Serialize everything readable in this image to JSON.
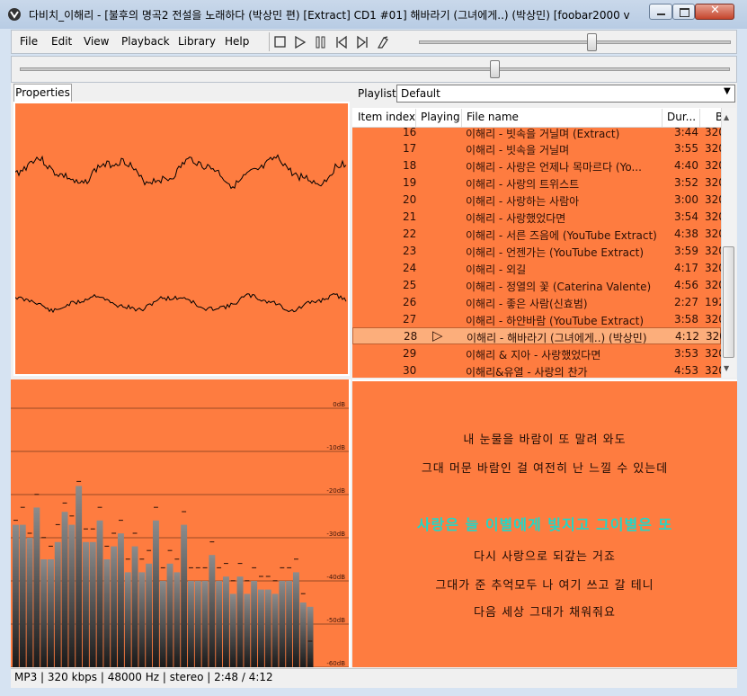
{
  "window": {
    "title": "다비치_이해리 - [불후의 명곡2 전설을 노래하다 (박상민 편) [Extract] CD1 #01] 해바라기 (그녀에게..) (박상민)     [foobar2000 v"
  },
  "menu": {
    "items": [
      "File",
      "Edit",
      "View",
      "Playback",
      "Library",
      "Help"
    ]
  },
  "toolbar": {
    "icons": [
      "stop-icon",
      "play-icon",
      "pause-icon",
      "previous-icon",
      "next-icon",
      "random-icon"
    ],
    "volume_level": 0.55
  },
  "seek": {
    "position_fraction": 0.667
  },
  "properties_tab": {
    "label": "Properties"
  },
  "playlist": {
    "label": "Playlist:",
    "selected": "Default",
    "columns": [
      "Item index",
      "Playing",
      "File name",
      "Dur...",
      "B"
    ],
    "rows": [
      {
        "index": "16",
        "file": "이해리 - 빗속을 거닐며 (Extract)",
        "duration": "3:44",
        "bitrate": "320"
      },
      {
        "index": "17",
        "file": "이해리 - 빗속을 거닐며",
        "duration": "3:55",
        "bitrate": "320"
      },
      {
        "index": "18",
        "file": "이해리 - 사랑은 언제나 목마르다 (Yo...",
        "duration": "4:40",
        "bitrate": "320"
      },
      {
        "index": "19",
        "file": "이해리 - 사랑의 트위스트",
        "duration": "3:52",
        "bitrate": "320"
      },
      {
        "index": "20",
        "file": "이해리 - 사랑하는 사람아",
        "duration": "3:00",
        "bitrate": "320"
      },
      {
        "index": "21",
        "file": "이해리 - 사랑했었다면",
        "duration": "3:54",
        "bitrate": "320"
      },
      {
        "index": "22",
        "file": "이해리 - 서른 즈음에 (YouTube Extract)",
        "duration": "4:38",
        "bitrate": "320"
      },
      {
        "index": "23",
        "file": "이해리 - 언젠가는 (YouTube Extract)",
        "duration": "3:59",
        "bitrate": "320"
      },
      {
        "index": "24",
        "file": "이해리 - 외길",
        "duration": "4:17",
        "bitrate": "320"
      },
      {
        "index": "25",
        "file": "이해리 - 정열의 꽃 (Caterina Valente)",
        "duration": "4:56",
        "bitrate": "320"
      },
      {
        "index": "26",
        "file": "이해리 - 좋은 사람(신효범)",
        "duration": "2:27",
        "bitrate": "192"
      },
      {
        "index": "27",
        "file": "이해리 - 하얀바람 (YouTube Extract)",
        "duration": "3:58",
        "bitrate": "320"
      },
      {
        "index": "28",
        "file": "이해리 - 해바라기 (그녀에게..) (박상민)",
        "duration": "4:12",
        "bitrate": "320",
        "playing": true
      },
      {
        "index": "29",
        "file": "이해리 & 지아 - 사랑했었다면",
        "duration": "3:53",
        "bitrate": "320"
      },
      {
        "index": "30",
        "file": "이해리&유열 - 사랑의 찬가",
        "duration": "4:53",
        "bitrate": "320"
      }
    ]
  },
  "spectrum": {
    "db_labels": [
      "0dB",
      "-10dB",
      "-20dB",
      "-30dB",
      "-40dB",
      "-50dB",
      "-60dB"
    ],
    "bars_db": [
      -27,
      -27,
      -30,
      -23,
      -35,
      -35,
      -31,
      -24,
      -27,
      -18,
      -31,
      -31,
      -26,
      -35,
      -32,
      -29,
      -38,
      -32,
      -38,
      -36,
      -26,
      -40,
      -36,
      -38,
      -27,
      -40,
      -40,
      -40,
      -34,
      -40,
      -39,
      -43,
      -39,
      -43,
      -40,
      -42,
      -42,
      -43,
      -40,
      -40,
      -38,
      -45,
      -46
    ],
    "peaks_db": [
      -27,
      -24,
      -30,
      -21,
      -31,
      -33,
      -28,
      -23,
      -26,
      -18,
      -29,
      -29,
      -24,
      -33,
      -30,
      -27,
      -36,
      -30,
      -36,
      -34,
      -24,
      -38,
      -34,
      -36,
      -25,
      -38,
      -38,
      -38,
      -32,
      -38,
      -37,
      -41,
      -37,
      -41,
      -38,
      -40,
      -40,
      -41,
      -38,
      -38,
      -36,
      -44,
      -55
    ]
  },
  "lyrics": {
    "lines": [
      {
        "text": "내 눈물을 바람이 또 말려 와도",
        "highlight": false
      },
      {
        "text": "그대 머문 바람인 걸 여전히 난 느낄 수 있는데",
        "highlight": false
      },
      {
        "text": "",
        "highlight": false
      },
      {
        "text": "사랑은 늘 이별에게 빛지고 그이별은 또",
        "highlight": true
      },
      {
        "text": "다시 사랑으로 되갚는 거죠",
        "highlight": false
      },
      {
        "text": "그대가 준 추억모두 나 여기 쓰고 갈 테니",
        "highlight": false
      },
      {
        "text": "다음 세상 그대가 채워줘요",
        "highlight": false
      }
    ]
  },
  "status": {
    "text": "MP3 | 320 kbps | 48000 Hz | stereo | 2:48 / 4:12"
  },
  "colors": {
    "visual_bg": "#fe7c40",
    "lyric_highlight": "#22d7c7"
  }
}
